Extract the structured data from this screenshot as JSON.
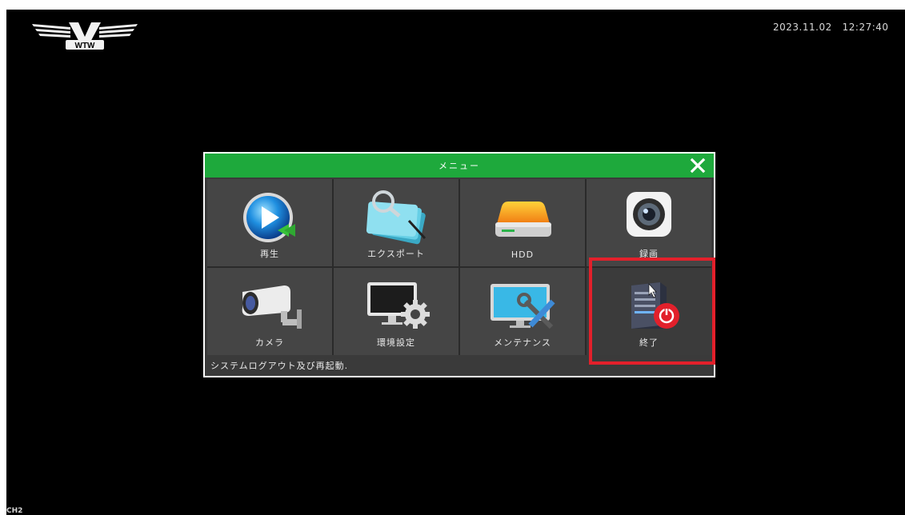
{
  "header": {
    "datetime": "2023.11.02   12:27:40",
    "logo_text": "WTW"
  },
  "menu": {
    "title": "メニュー",
    "items": [
      {
        "label": "再生",
        "icon": "playback-icon"
      },
      {
        "label": "エクスポート",
        "icon": "export-folder-icon"
      },
      {
        "label": "HDD",
        "icon": "hdd-icon"
      },
      {
        "label": "録画",
        "icon": "record-camera-icon"
      },
      {
        "label": "カメラ",
        "icon": "cctv-camera-icon"
      },
      {
        "label": "環境設定",
        "icon": "settings-monitor-icon"
      },
      {
        "label": "メンテナンス",
        "icon": "maintenance-tools-icon"
      },
      {
        "label": "終了",
        "icon": "shutdown-server-icon"
      }
    ],
    "status_text": "システムログアウト及び再起動."
  },
  "footer": {
    "channel": "CH2"
  },
  "colors": {
    "titlebar": "#1ea93c",
    "highlight": "#e3202b",
    "tile_bg": "#454545",
    "screen_bg": "#000000"
  }
}
